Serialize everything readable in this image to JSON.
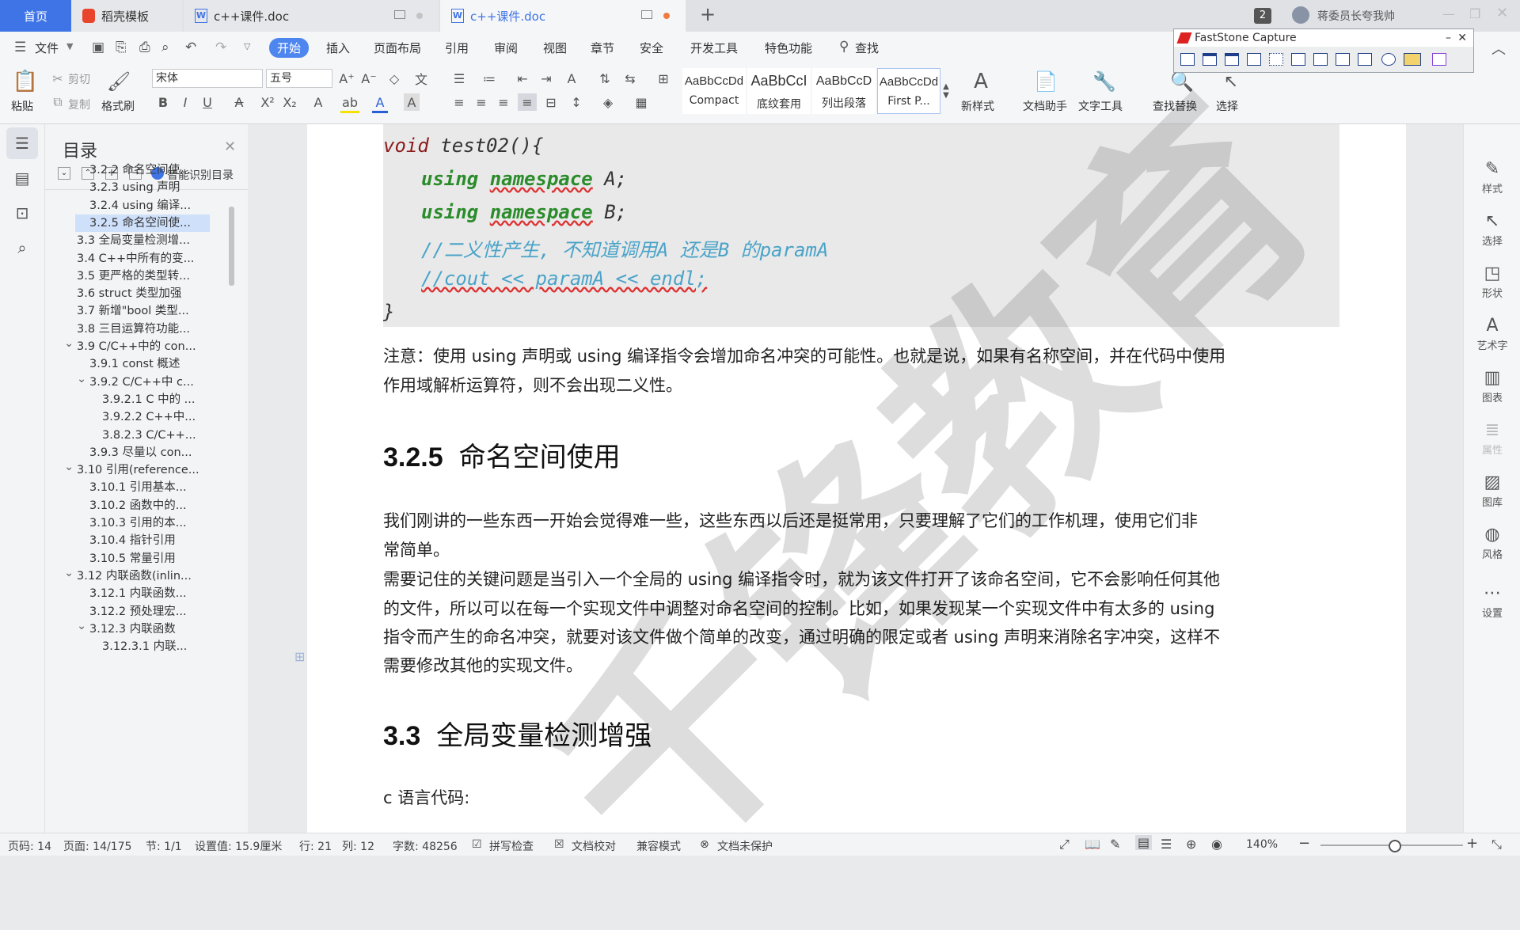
{
  "tabs": {
    "home": "首页",
    "template": "稻壳模板",
    "doc1": "c++课件.doc",
    "doc2": "c++课件.doc",
    "add": "+"
  },
  "titlebar": {
    "count_badge": "2",
    "user": "蒋委员长夸我帅"
  },
  "menu": {
    "file": "文件",
    "items": [
      "开始",
      "插入",
      "页面布局",
      "引用",
      "审阅",
      "视图",
      "章节",
      "安全",
      "开发工具",
      "特色功能"
    ],
    "search": "查找"
  },
  "ribbon": {
    "paste": "粘贴",
    "cut": "剪切",
    "copy": "复制",
    "format_painter": "格式刷",
    "font": "宋体",
    "size": "五号",
    "styles": [
      {
        "preview": "AaBbCcDd",
        "name": "Compact"
      },
      {
        "preview": "AaBbCcI",
        "name": "底纹套用"
      },
      {
        "preview": "AaBbCcD",
        "name": "列出段落"
      },
      {
        "preview": "AaBbCcDd",
        "name": "First P..."
      }
    ],
    "new_style": "新样式",
    "doc_assistant": "文档助手",
    "text_tools": "文字工具",
    "find_replace": "查找替换",
    "select": "选择"
  },
  "faststone": {
    "title": "FastStone Capture"
  },
  "toc": {
    "title": "目录",
    "smart": "智能识别目录",
    "items": [
      {
        "label": "3.2.2 命名空间使...",
        "level": 2
      },
      {
        "label": "3.2.3 using 声明",
        "level": 2
      },
      {
        "label": "3.2.4 using 编译...",
        "level": 2
      },
      {
        "label": "3.2.5  命名空间使...",
        "level": 2,
        "selected": true
      },
      {
        "label": "3.3  全局变量检测增...",
        "level": 1
      },
      {
        "label": "3.4 C++中所有的变...",
        "level": 1
      },
      {
        "label": "3.5  更严格的类型转...",
        "level": 1
      },
      {
        "label": "3.6 struct 类型加强",
        "level": 1
      },
      {
        "label": "3.7  新增\"bool 类型...",
        "level": 1
      },
      {
        "label": "3.8  三目运算符功能...",
        "level": 1
      },
      {
        "label": "3.9 C/C++中的 con...",
        "level": 1,
        "expanded": true
      },
      {
        "label": "3.9.1 const 概述",
        "level": 2
      },
      {
        "label": "3.9.2 C/C++中 c...",
        "level": 2,
        "expanded": true
      },
      {
        "label": "3.9.2.1 C 中的 ...",
        "level": 3
      },
      {
        "label": "3.9.2.2 C++中...",
        "level": 3
      },
      {
        "label": "3.8.2.3 C/C++...",
        "level": 3
      },
      {
        "label": "3.9.3  尽量以 con...",
        "level": 2
      },
      {
        "label": "3.10  引用(reference...",
        "level": 1,
        "expanded": true
      },
      {
        "label": "3.10.1  引用基本...",
        "level": 2
      },
      {
        "label": "3.10.2  函数中的...",
        "level": 2
      },
      {
        "label": "3.10.3  引用的本...",
        "level": 2
      },
      {
        "label": "3.10.4  指针引用",
        "level": 2
      },
      {
        "label": "3.10.5  常量引用",
        "level": 2
      },
      {
        "label": "3.12  内联函数(inlin...",
        "level": 1,
        "expanded": true
      },
      {
        "label": "3.12.1  内联函数...",
        "level": 2
      },
      {
        "label": "3.12.2  预处理宏...",
        "level": 2
      },
      {
        "label": "3.12.3  内联函数",
        "level": 2,
        "expanded": true
      },
      {
        "label": "3.12.3.1  内联...",
        "level": 3
      }
    ]
  },
  "document": {
    "code": {
      "line1_kw": "void",
      "line1_rest": " test02(){",
      "line2_a": "using",
      "line2_b": "namespace",
      "line2_c": " A;",
      "line3_a": "using",
      "line3_b": "namespace",
      "line3_c": " B;",
      "line4": "//二义性产生, 不知道调用A 还是B 的paramA",
      "line5": "//cout << paramA << endl;",
      "line6": "}"
    },
    "note_line1": "注意：使用 using 声明或 using 编译指令会增加命名冲突的可能性。也就是说，如果有名称空间，并在代码中使用",
    "note_line2": "作用域解析运算符，则不会出现二义性。",
    "heading1_num": "3.2.5",
    "heading1_text": "命名空间使用",
    "p1_line1": "我们刚讲的一些东西一开始会觉得难一些，这些东西以后还是挺常用，只要理解了它们的工作机理，使用它们非",
    "p1_line2": "常简单。",
    "p2_line1": "需要记住的关键问题是当引入一个全局的 using 编译指令时，就为该文件打开了该命名空间，它不会影响任何其他",
    "p2_line2": "的文件，所以可以在每一个实现文件中调整对命名空间的控制。比如，如果发现某一个实现文件中有太多的 using",
    "p2_line3": "指令而产生的命名冲突，就要对该文件做个简单的改变，通过明确的限定或者 using 声明来消除名字冲突，这样不",
    "p2_line4": "需要修改其他的实现文件。",
    "heading2_num": "3.3",
    "heading2_text": "全局变量检测增强",
    "p3": "c 语言代码:",
    "watermark": "千锋教育"
  },
  "right_rail": [
    "样式",
    "选择",
    "形状",
    "艺术字",
    "图表",
    "属性",
    "图库",
    "风格",
    "设置"
  ],
  "status": {
    "page_num": "页码: 14",
    "pages": "页面: 14/175",
    "section": "节: 1/1",
    "setting": "设置值: 15.9厘米",
    "row": "行: 21",
    "col": "列: 12",
    "words": "字数: 48256",
    "spell": "拼写检查",
    "proof": "文档校对",
    "compat": "兼容模式",
    "protect": "文档未保护",
    "zoom": "140%"
  },
  "colors": {
    "accent": "#3f74e6",
    "keyword": "#8b1a1a",
    "namespace_kw": "#2b8c2b",
    "comment": "#4aa3c8"
  }
}
